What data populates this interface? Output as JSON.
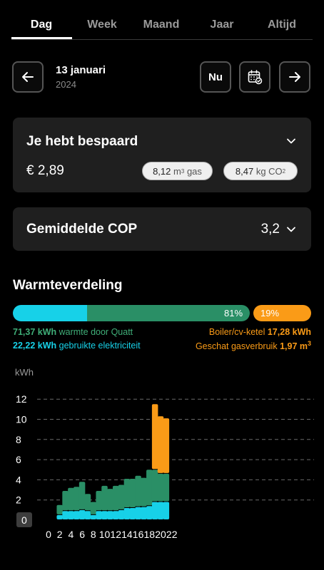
{
  "tabs": [
    {
      "label": "Dag",
      "active": true
    },
    {
      "label": "Week",
      "active": false
    },
    {
      "label": "Maand",
      "active": false
    },
    {
      "label": "Jaar",
      "active": false
    },
    {
      "label": "Altijd",
      "active": false
    }
  ],
  "date": {
    "main": "13 januari",
    "year": "2024",
    "now_label": "Nu"
  },
  "savings": {
    "title": "Je hebt bespaard",
    "amount": "€ 2,89",
    "gas_value": "8,12",
    "gas_unit": "m",
    "gas_unit_sup": "3",
    "gas_suffix": "gas",
    "co2_value": "8,47",
    "co2_unit": "kg",
    "co2_label": "CO",
    "co2_sub": "2"
  },
  "cop": {
    "title": "Gemiddelde COP",
    "value": "3,2"
  },
  "distribution": {
    "title": "Warmteverdeling",
    "quatt_pct": 81,
    "boiler_pct": 19,
    "quatt_pct_label": "81%",
    "boiler_pct_label": "19%",
    "heat_quatt_value": "71,37 kWh",
    "heat_quatt_label": "warmte door Quatt",
    "electricity_value": "22,22 kWh",
    "electricity_label": "gebruikte elektriciteit",
    "boiler_label": "Boiler/cv-ketel",
    "boiler_value": "17,28 kWh",
    "gas_label": "Geschat gasverbruik",
    "gas_value": "1,97 m",
    "gas_sup": "3"
  },
  "colors": {
    "cyan": "#17d1e8",
    "green": "#2a8f66",
    "orange": "#fa9b17"
  },
  "chart_data": {
    "type": "bar",
    "stacked": true,
    "ylabel": "kWh",
    "ylim": [
      0,
      12
    ],
    "yticks": [
      0,
      2,
      4,
      6,
      8,
      10,
      12
    ],
    "xticks": [
      0,
      2,
      4,
      6,
      8,
      10,
      12,
      14,
      16,
      18,
      20,
      22
    ],
    "grid": true,
    "x": [
      2,
      3,
      4,
      5,
      6,
      7,
      8,
      9,
      10,
      11,
      12,
      13,
      14,
      15,
      16,
      17,
      18,
      19,
      20,
      21
    ],
    "series": [
      {
        "color": "#17d1e8",
        "values": [
          0.5,
          0.9,
          0.9,
          0.9,
          1.0,
          0.9,
          0.5,
          0.9,
          0.9,
          0.9,
          0.9,
          1.0,
          1.2,
          1.2,
          1.3,
          1.3,
          1.4,
          1.8,
          1.8,
          1.8
        ]
      },
      {
        "color": "#2a8f66",
        "values": [
          1.0,
          2.0,
          2.3,
          2.4,
          2.8,
          1.7,
          1.3,
          2.0,
          2.5,
          2.2,
          2.5,
          2.5,
          2.9,
          2.9,
          3.1,
          2.9,
          3.6,
          3.2,
          2.8,
          2.8
        ]
      },
      {
        "color": "#fa9b17",
        "values": [
          0,
          0,
          0,
          0,
          0,
          0,
          0,
          0,
          0,
          0,
          0,
          0,
          0,
          0,
          0,
          0,
          0,
          6.5,
          5.7,
          5.5
        ]
      }
    ]
  }
}
